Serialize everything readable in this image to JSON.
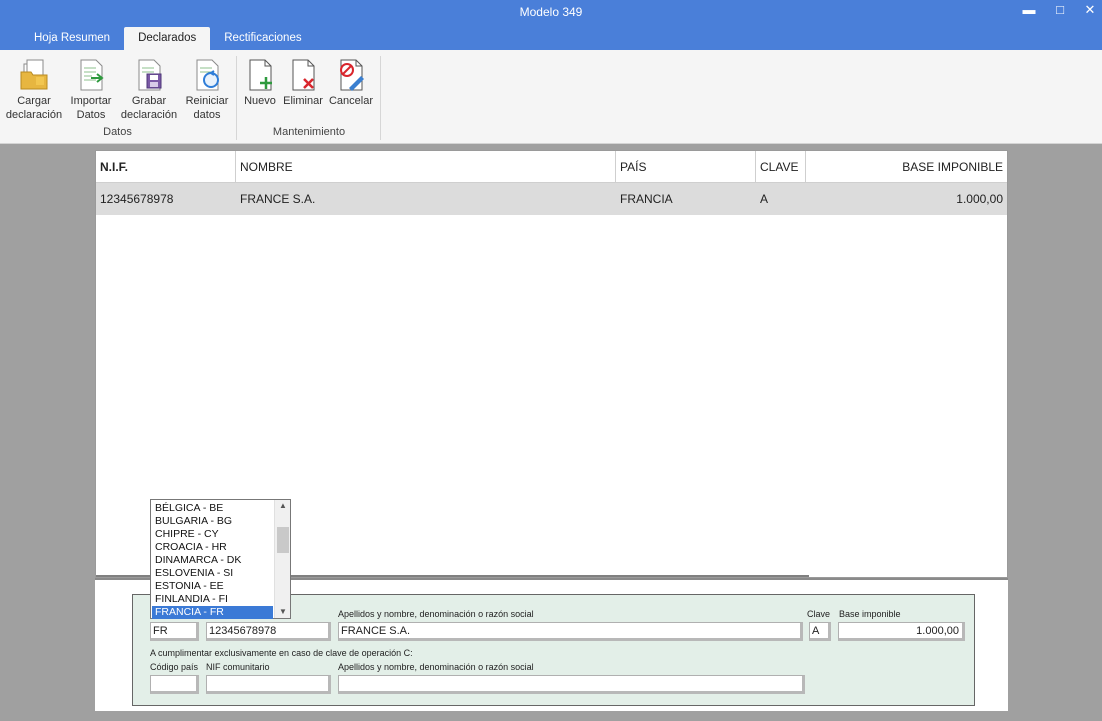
{
  "window": {
    "title": "Modelo 349",
    "minimize": "▬",
    "maximize": "□",
    "close": "✕"
  },
  "tabs": [
    {
      "label": "Hoja Resumen"
    },
    {
      "label": "Declarados"
    },
    {
      "label": "Rectificaciones"
    }
  ],
  "ribbon": {
    "datos": {
      "label": "Datos",
      "buttons": [
        {
          "line1": "Cargar",
          "line2": "declaración",
          "icon": "folder-load-icon"
        },
        {
          "line1": "Importar",
          "line2": "Datos",
          "icon": "import-doc-icon"
        },
        {
          "line1": "Grabar",
          "line2": "declaración",
          "icon": "save-doc-icon"
        },
        {
          "line1": "Reiniciar",
          "line2": "datos",
          "icon": "reset-doc-icon"
        }
      ]
    },
    "mantenimiento": {
      "label": "Mantenimiento",
      "buttons": [
        {
          "line1": "Nuevo",
          "icon": "new-doc-icon"
        },
        {
          "line1": "Eliminar",
          "icon": "delete-doc-icon"
        },
        {
          "line1": "Cancelar",
          "icon": "cancel-doc-icon"
        }
      ]
    }
  },
  "table": {
    "columns": [
      "N.I.F.",
      "NOMBRE",
      "PAÍS",
      "CLAVE",
      "BASE IMPONIBLE"
    ],
    "rows": [
      {
        "nif": "12345678978",
        "nombre": "FRANCE S.A.",
        "pais": "FRANCIA",
        "clave": "A",
        "base": "1.000,00"
      }
    ]
  },
  "form": {
    "label_nombre": "Apellidos y nombre, denominación o razón social",
    "label_clave": "Clave",
    "label_base": "Base imponible",
    "pais_code": "FR",
    "nif": "12345678978",
    "nombre": "FRANCE S.A.",
    "clave": "A",
    "base": "1.000,00",
    "clave_c_note": "A cumplimentar exclusivamente en caso de clave de operación C:",
    "label_codigo_pais": "Código país",
    "label_nif_comunitario": "NIF comunitario",
    "label_nombre_c": "Apellidos y nombre, denominación o razón social",
    "codigo_pais_c": "",
    "nif_comunitario_c": "",
    "nombre_c": ""
  },
  "country_dropdown": {
    "items": [
      "BÉLGICA - BE",
      "BULGARIA - BG",
      "CHIPRE - CY",
      "CROACIA - HR",
      "DINAMARCA - DK",
      "ESLOVENIA - SI",
      "ESTONIA - EE",
      "FINLANDIA - FI",
      "FRANCIA - FR"
    ],
    "selected": "FRANCIA - FR"
  },
  "colors": {
    "titlebar": "#4a7fd9",
    "selection": "#3b7ad6",
    "panel": "#e3efe8"
  }
}
